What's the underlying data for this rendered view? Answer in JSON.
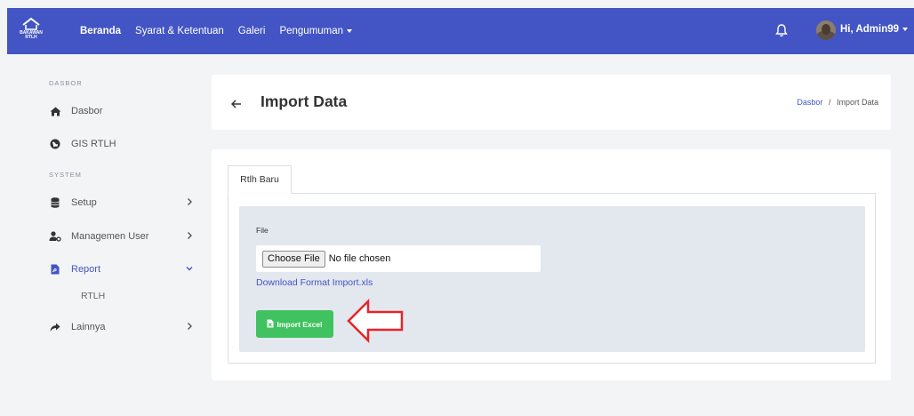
{
  "brand": {
    "logo_text_1": "BAKAWAN",
    "logo_text_2": "RTLH"
  },
  "nav": {
    "items": [
      {
        "label": "Beranda"
      },
      {
        "label": "Syarat & Ketentuan"
      },
      {
        "label": "Galeri"
      },
      {
        "label": "Pengumuman"
      }
    ],
    "user_label": "Hi, Admin99"
  },
  "sidebar": {
    "heading_dasbor": "DASBOR",
    "heading_system": "SYSTEM",
    "items": [
      {
        "label": "Dasbor"
      },
      {
        "label": "GIS RTLH"
      },
      {
        "label": "Setup"
      },
      {
        "label": "Managemen User"
      },
      {
        "label": "Report"
      },
      {
        "label": "Lainnya"
      }
    ],
    "report_sub": "RTLH"
  },
  "page": {
    "title": "Import Data",
    "breadcrumb_link": "Dasbor",
    "breadcrumb_sep": "/",
    "breadcrumb_current": "Import Data"
  },
  "form": {
    "tab_label": "Rtlh Baru",
    "file_label": "File",
    "choose_file": "Choose File",
    "no_file": "No file chosen",
    "download_link": "Download Format Import.xls",
    "import_button": "Import Excel"
  },
  "colors": {
    "primary": "#4355c4",
    "success": "#3fc25f",
    "annotation_arrow": "#e8232a"
  }
}
